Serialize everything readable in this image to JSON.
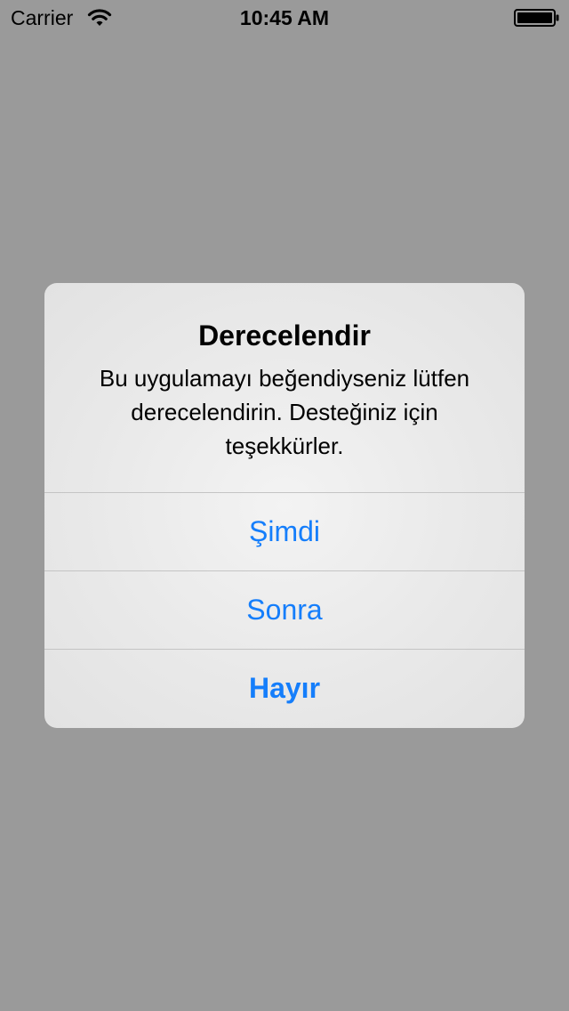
{
  "status_bar": {
    "carrier": "Carrier",
    "time": "10:45 AM"
  },
  "icons": {
    "wifi": "wifi-icon",
    "battery": "battery-icon"
  },
  "alert": {
    "title": "Derecelendir",
    "message": "Bu uygulamayı beğendiyseniz lütfen derecelendirin. Desteğiniz için teşekkürler.",
    "buttons": [
      {
        "label": "Şimdi"
      },
      {
        "label": "Sonra"
      },
      {
        "label": "Hayır"
      }
    ]
  },
  "colors": {
    "background": "#9a9a9a",
    "alert_background": "#ececec",
    "button_text": "#157efb",
    "separator": "#c4c4c4"
  }
}
